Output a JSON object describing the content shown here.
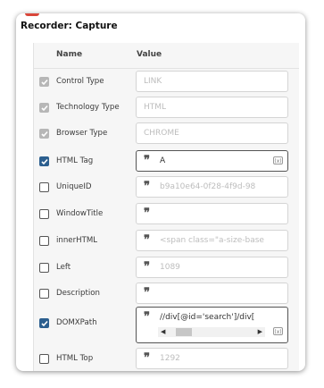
{
  "dialog": {
    "title": "Recorder: Capture"
  },
  "header": {
    "name": "Name",
    "value": "Value"
  },
  "rows": [
    {
      "label": "Control Type",
      "checked": true,
      "disabled": true,
      "value": "LINK"
    },
    {
      "label": "Technology Type",
      "checked": true,
      "disabled": true,
      "value": "HTML"
    },
    {
      "label": "Browser Type",
      "checked": true,
      "disabled": true,
      "value": "CHROME"
    },
    {
      "label": "HTML Tag",
      "checked": true,
      "disabled": false,
      "value": "A"
    },
    {
      "label": "UniqueID",
      "checked": false,
      "disabled": false,
      "value": "b9a10e64-0f28-4f9d-98"
    },
    {
      "label": "WindowTitle",
      "checked": false,
      "disabled": false,
      "value": ""
    },
    {
      "label": "innerHTML",
      "checked": false,
      "disabled": false,
      "value": "<span class=\"a-size-base"
    },
    {
      "label": "Left",
      "checked": false,
      "disabled": false,
      "value": "1089"
    },
    {
      "label": "Description",
      "checked": false,
      "disabled": false,
      "value": ""
    },
    {
      "label": "DOMXPath",
      "checked": true,
      "disabled": false,
      "value": "//div[@id='search']/div["
    },
    {
      "label": "HTML Top",
      "checked": false,
      "disabled": false,
      "value": "1292"
    }
  ],
  "icons": {
    "quote": "quote-icon",
    "variable": "variable-icon",
    "check": "check-icon"
  },
  "colors": {
    "checked": "#2c5f8f",
    "disabled_checked": "#b7b7b7",
    "accent": "#d9463a"
  }
}
